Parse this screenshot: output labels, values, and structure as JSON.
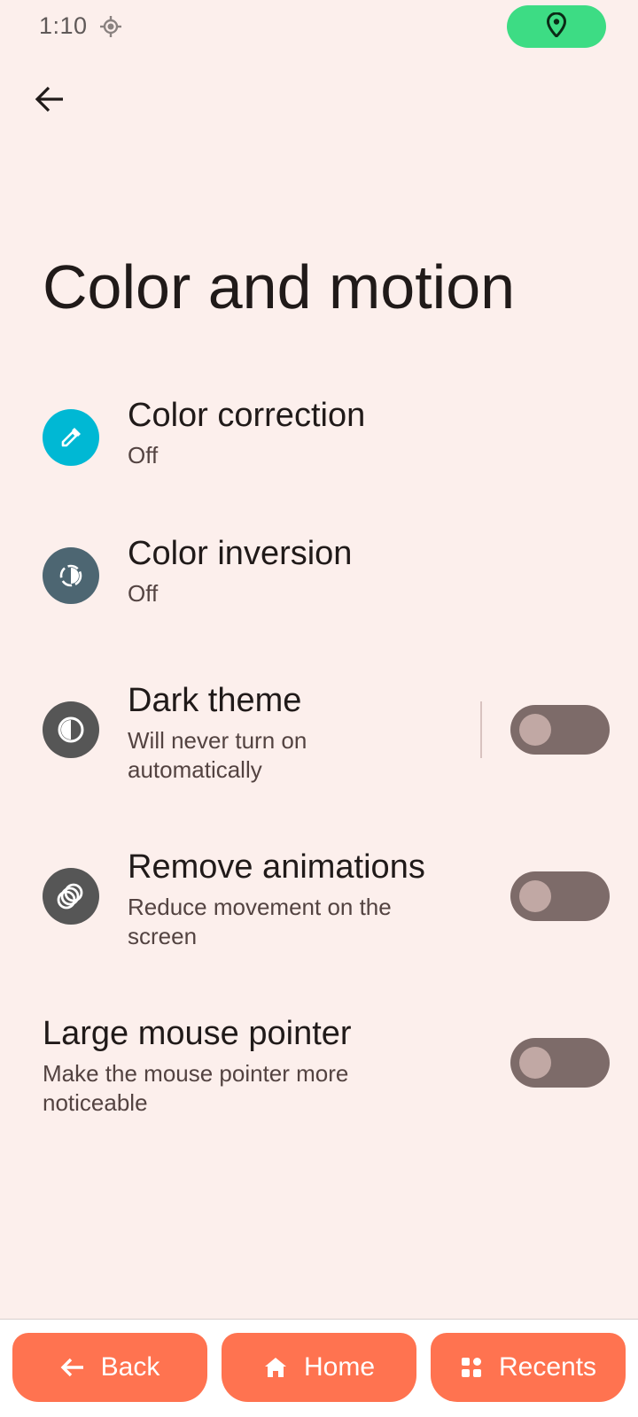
{
  "status_bar": {
    "time": "1:10",
    "icons": [
      "location-crosshair-icon",
      "location-pin-icon"
    ],
    "pill_color": "#3ddc84"
  },
  "header": {
    "back_icon": "arrow-left-icon",
    "title": "Color and motion"
  },
  "preferences": [
    {
      "title": "Color correction",
      "summary": "Off",
      "icon": "eyedropper-icon",
      "icon_color": "#00b8d4"
    },
    {
      "title": "Color inversion",
      "summary": "Off",
      "icon": "color-inversion-icon",
      "icon_color": "#4d6672"
    },
    {
      "title": "Dark theme",
      "summary": "Will never turn on automatically",
      "icon": "contrast-icon",
      "icon_color": "#565656",
      "toggle": false
    },
    {
      "title": "Remove animations",
      "summary": "Reduce movement on the screen",
      "icon": "animation-icon",
      "icon_color": "#565656",
      "toggle": false
    },
    {
      "title": "Large mouse pointer",
      "summary": "Make the mouse pointer more noticeable",
      "toggle": false
    }
  ],
  "nav": {
    "back_label": "Back",
    "home_label": "Home",
    "recents_label": "Recents",
    "button_color": "#ff7350"
  }
}
